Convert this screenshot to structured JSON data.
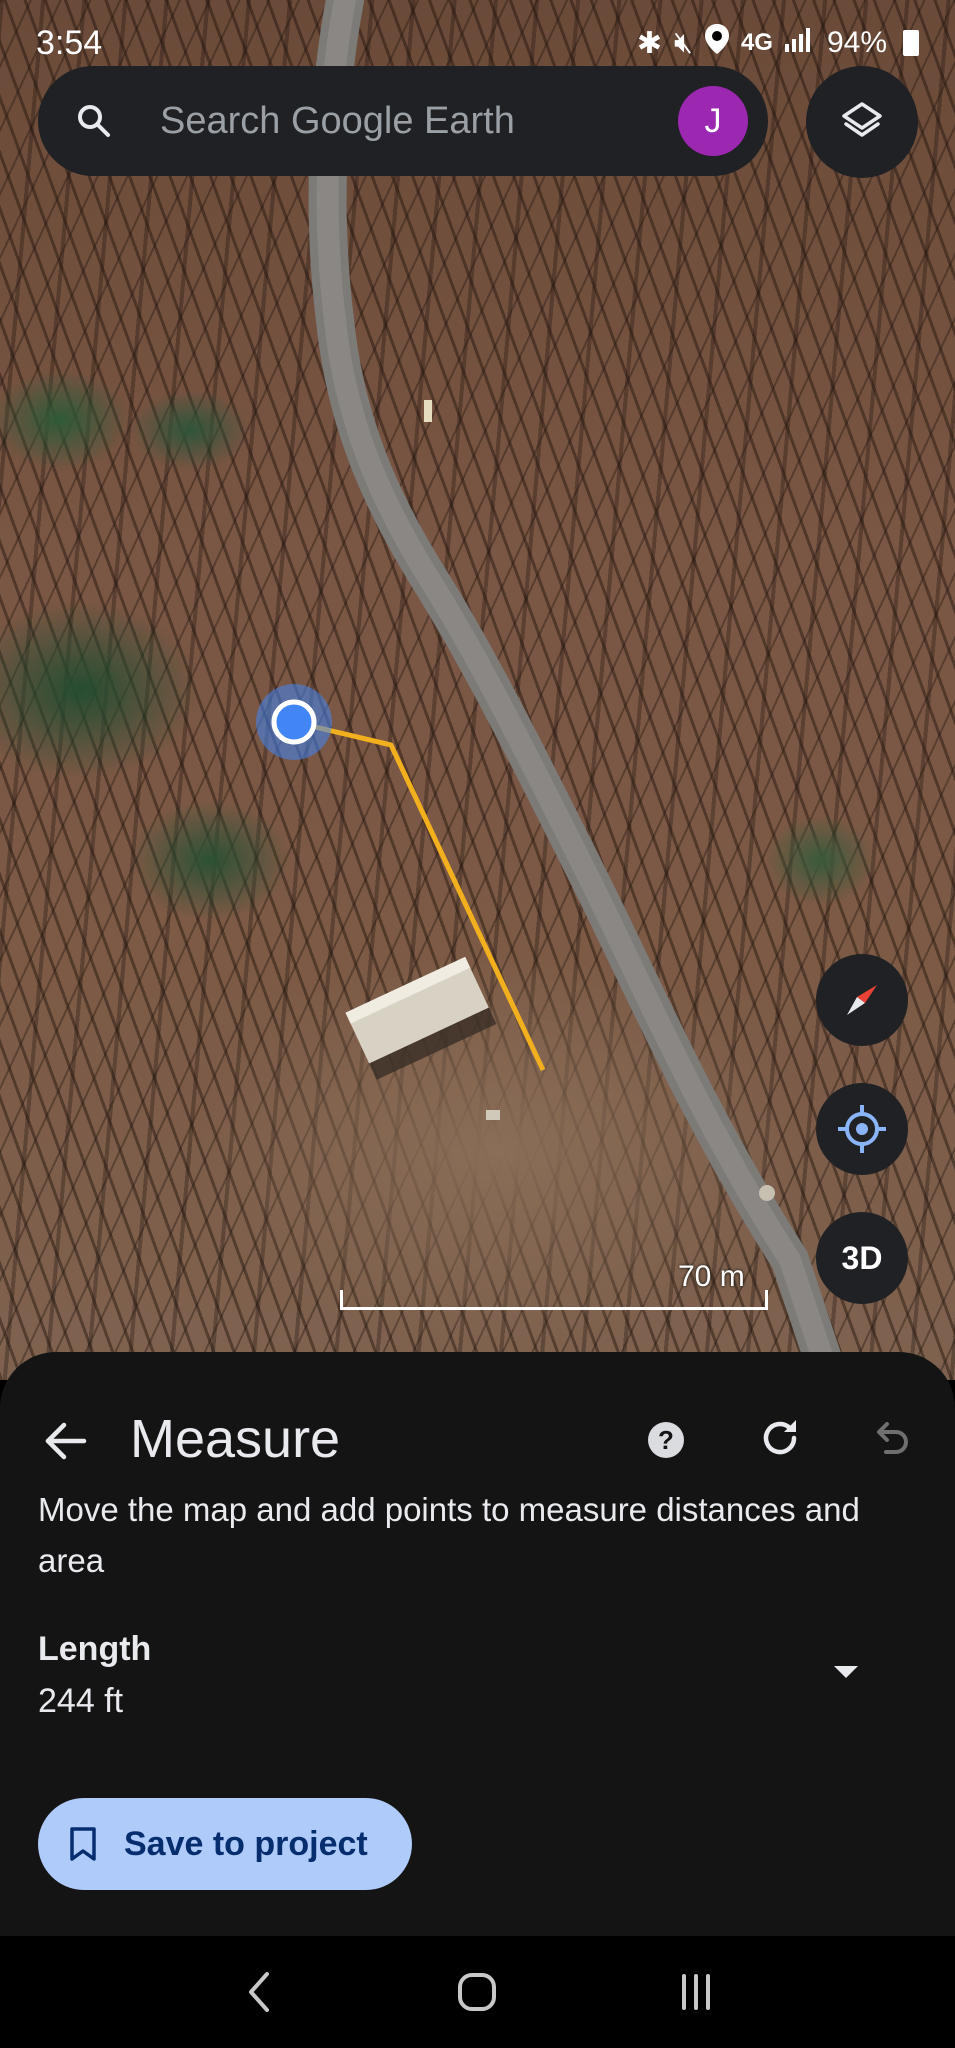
{
  "status_bar": {
    "time": "3:54",
    "network": "4G",
    "battery": "94%"
  },
  "search": {
    "placeholder": "Search Google Earth",
    "avatar_initial": "J",
    "avatar_color": "#9c27b0"
  },
  "map": {
    "scale_label": "70 m",
    "controls": [
      "compass-icon",
      "my-location-icon",
      "3D"
    ],
    "view_mode_label": "3D",
    "measure_line_color": "#f2b01e",
    "point_color": "#4285f4"
  },
  "measure_panel": {
    "title": "Measure",
    "description": "Move the map and add points to measure distances and area",
    "metric_label": "Length",
    "metric_value": "244 ft",
    "save_label": "Save to project",
    "icons": [
      "back-arrow-icon",
      "help-icon",
      "refresh-icon",
      "undo-icon",
      "dropdown-arrow-icon",
      "bookmark-icon"
    ]
  },
  "nav_bar": {
    "buttons": [
      "back",
      "home",
      "recents"
    ]
  },
  "colors": {
    "sheet_bg": "#141414",
    "save_button_bg": "#aecbfa",
    "save_button_text": "#062e6f"
  }
}
